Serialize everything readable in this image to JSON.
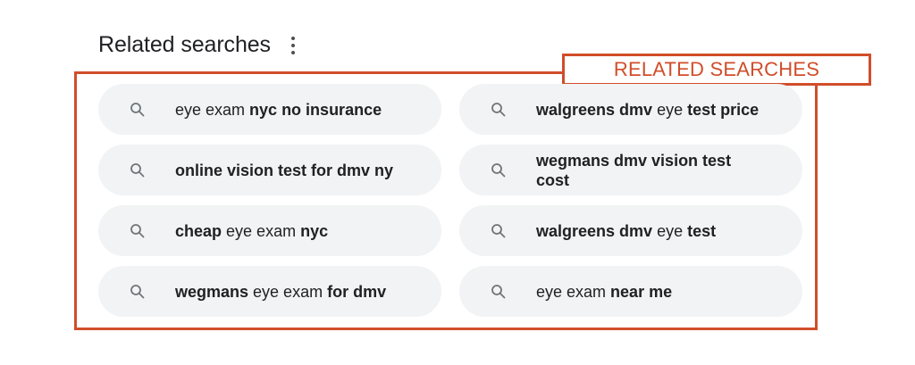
{
  "header": {
    "title": "Related searches"
  },
  "annotation": {
    "label": "RELATED SEARCHES",
    "color": "#d14d2a"
  },
  "searches": [
    {
      "parts": [
        {
          "t": "eye exam ",
          "b": false
        },
        {
          "t": "nyc no insurance",
          "b": true
        }
      ]
    },
    {
      "parts": [
        {
          "t": "walgreens dmv",
          "b": true
        },
        {
          "t": " eye ",
          "b": false
        },
        {
          "t": "test price",
          "b": true
        }
      ]
    },
    {
      "parts": [
        {
          "t": "online vision test for dmv ny",
          "b": true
        }
      ]
    },
    {
      "parts": [
        {
          "t": "wegmans dmv vision test cost",
          "b": true
        }
      ]
    },
    {
      "parts": [
        {
          "t": "cheap",
          "b": true
        },
        {
          "t": " eye exam ",
          "b": false
        },
        {
          "t": "nyc",
          "b": true
        }
      ]
    },
    {
      "parts": [
        {
          "t": "walgreens dmv",
          "b": true
        },
        {
          "t": " eye ",
          "b": false
        },
        {
          "t": "test",
          "b": true
        }
      ]
    },
    {
      "parts": [
        {
          "t": "wegmans",
          "b": true
        },
        {
          "t": " eye exam ",
          "b": false
        },
        {
          "t": "for dmv",
          "b": true
        }
      ]
    },
    {
      "parts": [
        {
          "t": "eye exam ",
          "b": false
        },
        {
          "t": "near me",
          "b": true
        }
      ]
    }
  ],
  "icons": {
    "chip_icon": "search-icon",
    "menu_icon": "more-vert-icon"
  },
  "colors": {
    "chip_bg": "#f1f3f4",
    "text": "#202124",
    "icon": "#70757a"
  }
}
